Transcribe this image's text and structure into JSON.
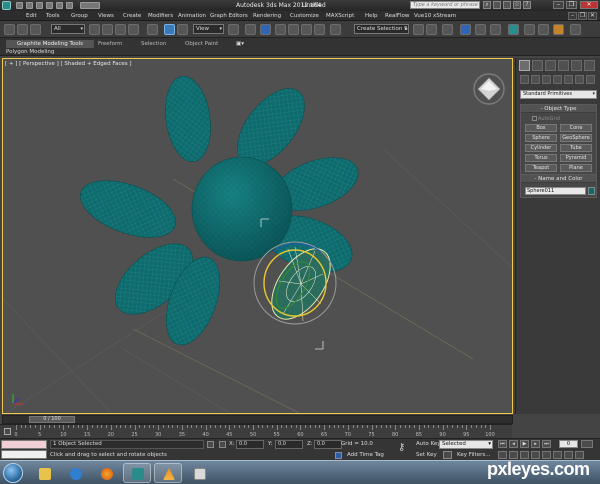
{
  "window": {
    "title": "Autodesk 3ds Max  2012 x64",
    "document": "Untitled",
    "search_placeholder": "Type a keyword or phrase"
  },
  "menu": [
    "Edit",
    "Tools",
    "Group",
    "Views",
    "Create",
    "Modifiers",
    "Animation",
    "Graph Editors",
    "Rendering",
    "Customize",
    "MAXScript",
    "Help",
    "RealFlow",
    "Vue10 xStream"
  ],
  "toolbar": {
    "selection_filter": "All",
    "reference_coord": "View",
    "named_selection": "Create Selection Se"
  },
  "ribbon": {
    "tabs": [
      "Graphite Modeling Tools",
      "Freeform",
      "Selection",
      "Object Paint"
    ],
    "sub_label": "Polygon Modeling"
  },
  "viewport": {
    "label": "[ + ] [ Perspective ] [ Shaded + Edged Faces ]",
    "object_color": "#0e6a6c"
  },
  "command_panel": {
    "category": "Standard Primitives",
    "object_type_title": "Object Type",
    "autogrid_label": "AutoGrid",
    "primitives": [
      "Box",
      "Cone",
      "Sphere",
      "GeoSphere",
      "Cylinder",
      "Tube",
      "Torus",
      "Pyramid",
      "Teapot",
      "Plane"
    ],
    "name_color_title": "Name and Color",
    "object_name": "Sphere011"
  },
  "timeline": {
    "slider_label": "0 / 100",
    "ticks": [
      "0",
      "5",
      "10",
      "15",
      "20",
      "25",
      "30",
      "35",
      "40",
      "45",
      "50",
      "55",
      "60",
      "65",
      "70",
      "75",
      "80",
      "85",
      "90",
      "95",
      "100"
    ]
  },
  "status": {
    "selection": "1 Object Selected",
    "prompt": "Click and drag to select and rotate objects",
    "x_label": "X:",
    "x_value": "0.0",
    "y_label": "Y:",
    "y_value": "0.0",
    "z_label": "Z:",
    "z_value": "0.0",
    "grid": "Grid = 10.0",
    "add_time_tag": "Add Time Tag",
    "auto_key": "Auto Key",
    "set_key": "Set Key",
    "key_mode": "Selected",
    "key_filters": "Key Filters...",
    "current_frame": "0"
  },
  "taskbar": {
    "apps": [
      "explorer",
      "media-player",
      "firefox",
      "3ds-max",
      "vlc",
      "paint"
    ]
  },
  "watermark": "pxleyes.com"
}
